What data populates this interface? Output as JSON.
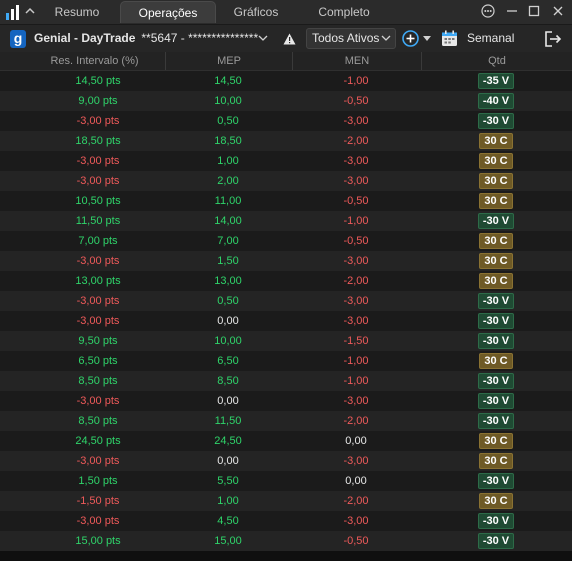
{
  "tabs": [
    {
      "label": "Resumo",
      "active": false
    },
    {
      "label": "Operações",
      "active": true
    },
    {
      "label": "Gráficos",
      "active": false
    },
    {
      "label": "Completo",
      "active": false
    }
  ],
  "toolbar": {
    "broker_badge": "g",
    "account_name": "Genial - DayTrade",
    "account_number": "**5647 - ***************",
    "asset_filter": "Todos Ativos",
    "period": "Semanal"
  },
  "columns": [
    "Res. Intervalo (%)",
    "MEP",
    "MEN",
    "Qtd"
  ],
  "colors": {
    "positive": "#2fd46a",
    "negative": "#ef5a5a",
    "sell_badge": "#1f4a33",
    "buy_badge": "#6e5a26"
  },
  "rows": [
    {
      "res": "14,50 pts",
      "mep": "14,50",
      "men": "-1,00",
      "qtd": "-35 V"
    },
    {
      "res": "9,00 pts",
      "mep": "10,00",
      "men": "-0,50",
      "qtd": "-40 V"
    },
    {
      "res": "-3,00 pts",
      "mep": "0,50",
      "men": "-3,00",
      "qtd": "-30 V"
    },
    {
      "res": "18,50 pts",
      "mep": "18,50",
      "men": "-2,00",
      "qtd": "30 C"
    },
    {
      "res": "-3,00 pts",
      "mep": "1,00",
      "men": "-3,00",
      "qtd": "30 C"
    },
    {
      "res": "-3,00 pts",
      "mep": "2,00",
      "men": "-3,00",
      "qtd": "30 C"
    },
    {
      "res": "10,50 pts",
      "mep": "11,00",
      "men": "-0,50",
      "qtd": "30 C"
    },
    {
      "res": "11,50 pts",
      "mep": "14,00",
      "men": "-1,00",
      "qtd": "-30 V"
    },
    {
      "res": "7,00 pts",
      "mep": "7,00",
      "men": "-0,50",
      "qtd": "30 C"
    },
    {
      "res": "-3,00 pts",
      "mep": "1,50",
      "men": "-3,00",
      "qtd": "30 C"
    },
    {
      "res": "13,00 pts",
      "mep": "13,00",
      "men": "-2,00",
      "qtd": "30 C"
    },
    {
      "res": "-3,00 pts",
      "mep": "0,50",
      "men": "-3,00",
      "qtd": "-30 V"
    },
    {
      "res": "-3,00 pts",
      "mep": "0,00",
      "men": "-3,00",
      "qtd": "-30 V"
    },
    {
      "res": "9,50 pts",
      "mep": "10,00",
      "men": "-1,50",
      "qtd": "-30 V"
    },
    {
      "res": "6,50 pts",
      "mep": "6,50",
      "men": "-1,00",
      "qtd": "30 C"
    },
    {
      "res": "8,50 pts",
      "mep": "8,50",
      "men": "-1,00",
      "qtd": "-30 V"
    },
    {
      "res": "-3,00 pts",
      "mep": "0,00",
      "men": "-3,00",
      "qtd": "-30 V"
    },
    {
      "res": "8,50 pts",
      "mep": "11,50",
      "men": "-2,00",
      "qtd": "-30 V"
    },
    {
      "res": "24,50 pts",
      "mep": "24,50",
      "men": "0,00",
      "qtd": "30 C"
    },
    {
      "res": "-3,00 pts",
      "mep": "0,00",
      "men": "-3,00",
      "qtd": "30 C"
    },
    {
      "res": "1,50 pts",
      "mep": "5,50",
      "men": "0,00",
      "qtd": "-30 V"
    },
    {
      "res": "-1,50 pts",
      "mep": "1,00",
      "men": "-2,00",
      "qtd": "30 C"
    },
    {
      "res": "-3,00 pts",
      "mep": "4,50",
      "men": "-3,00",
      "qtd": "-30 V"
    },
    {
      "res": "15,00 pts",
      "mep": "15,00",
      "men": "-0,50",
      "qtd": "-30 V"
    }
  ]
}
